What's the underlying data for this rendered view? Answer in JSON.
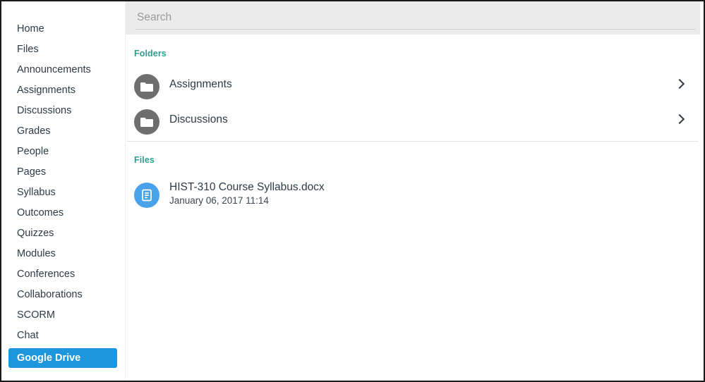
{
  "colors": {
    "accent_teal": "#2b9e8d",
    "active_blue": "#1e96dd",
    "folder_gray": "#6e6e6e",
    "doc_blue": "#4aa3ea",
    "search_bg": "#ebebeb",
    "text_dark": "#2d3b45"
  },
  "sidebar": {
    "items": [
      {
        "label": "Home",
        "active": false
      },
      {
        "label": "Files",
        "active": false
      },
      {
        "label": "Announcements",
        "active": false
      },
      {
        "label": "Assignments",
        "active": false
      },
      {
        "label": "Discussions",
        "active": false
      },
      {
        "label": "Grades",
        "active": false
      },
      {
        "label": "People",
        "active": false
      },
      {
        "label": "Pages",
        "active": false
      },
      {
        "label": "Syllabus",
        "active": false
      },
      {
        "label": "Outcomes",
        "active": false
      },
      {
        "label": "Quizzes",
        "active": false
      },
      {
        "label": "Modules",
        "active": false
      },
      {
        "label": "Conferences",
        "active": false
      },
      {
        "label": "Collaborations",
        "active": false
      },
      {
        "label": "SCORM",
        "active": false
      },
      {
        "label": "Chat",
        "active": false
      },
      {
        "label": "Google Drive",
        "active": true
      }
    ]
  },
  "search": {
    "placeholder": "Search",
    "value": ""
  },
  "folders_section": {
    "heading": "Folders",
    "items": [
      {
        "name": "Assignments",
        "icon": "folder-icon",
        "chevron": "chevron-right-icon"
      },
      {
        "name": "Discussions",
        "icon": "folder-icon",
        "chevron": "chevron-right-icon"
      }
    ]
  },
  "files_section": {
    "heading": "Files",
    "items": [
      {
        "name": "HIST-310 Course Syllabus.docx",
        "date": "January 06, 2017 11:14",
        "icon": "document-icon"
      }
    ]
  }
}
